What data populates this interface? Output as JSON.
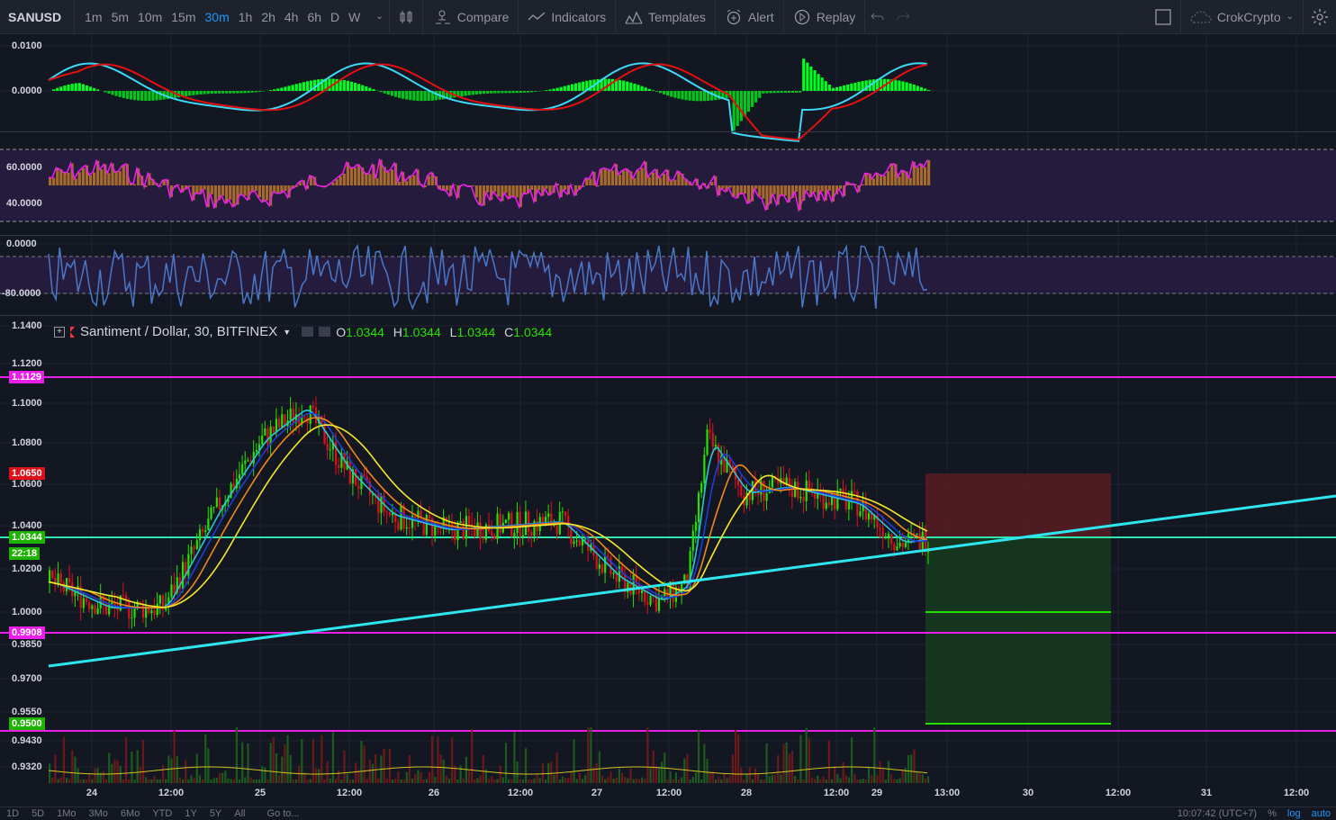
{
  "toolbar": {
    "symbol": "SANUSD",
    "intervals": [
      "1m",
      "5m",
      "10m",
      "15m",
      "30m",
      "1h",
      "2h",
      "4h",
      "6h",
      "D",
      "W"
    ],
    "active_interval": "30m",
    "compare": "Compare",
    "indicators": "Indicators",
    "templates": "Templates",
    "alert": "Alert",
    "replay": "Replay",
    "account": "CrokCrypto"
  },
  "macd_pane": {
    "labels": [
      "0.0100",
      "0.0000"
    ]
  },
  "rsi_pane": {
    "labels": [
      "60.0000",
      "40.0000"
    ]
  },
  "williams_pane": {
    "labels": [
      "0.0000",
      "-80.0000"
    ]
  },
  "main_pane": {
    "legend": {
      "title": "Santiment / Dollar, 30, BITFINEX",
      "o_label": "O",
      "o": "1.0344",
      "h_label": "H",
      "h": "1.0344",
      "l_label": "L",
      "l": "1.0344",
      "c_label": "C",
      "c": "1.0344"
    },
    "price_labels": [
      "1.1400",
      "1.1200",
      "1.1000",
      "1.0800",
      "1.0600",
      "1.0400",
      "1.0200",
      "1.0000",
      "0.9850",
      "0.9700",
      "0.9550",
      "0.9430",
      "0.9320"
    ],
    "badges": {
      "resistance": "1.1129",
      "stop": "1.0650",
      "current": "1.0344",
      "countdown": "22:18",
      "support": "0.9908",
      "target": "0.9500"
    },
    "colors": {
      "magenta": "#e91ee8",
      "cyan": "#2ee6f0",
      "up": "#26e000",
      "down": "#e0101a"
    }
  },
  "time_axis": [
    "24",
    "12:00",
    "25",
    "12:00",
    "26",
    "12:00",
    "27",
    "12:00",
    "28",
    "12:00",
    "29",
    "13:00",
    "30",
    "12:00",
    "31",
    "12:00"
  ],
  "bottombar": {
    "ranges": [
      "1D",
      "5D",
      "1Mo",
      "3Mo",
      "6Mo",
      "YTD",
      "1Y",
      "5Y",
      "All"
    ],
    "goto": "Go to...",
    "clock": "10:07:42 (UTC+7)",
    "percent": "%",
    "log": "log",
    "auto": "auto"
  }
}
